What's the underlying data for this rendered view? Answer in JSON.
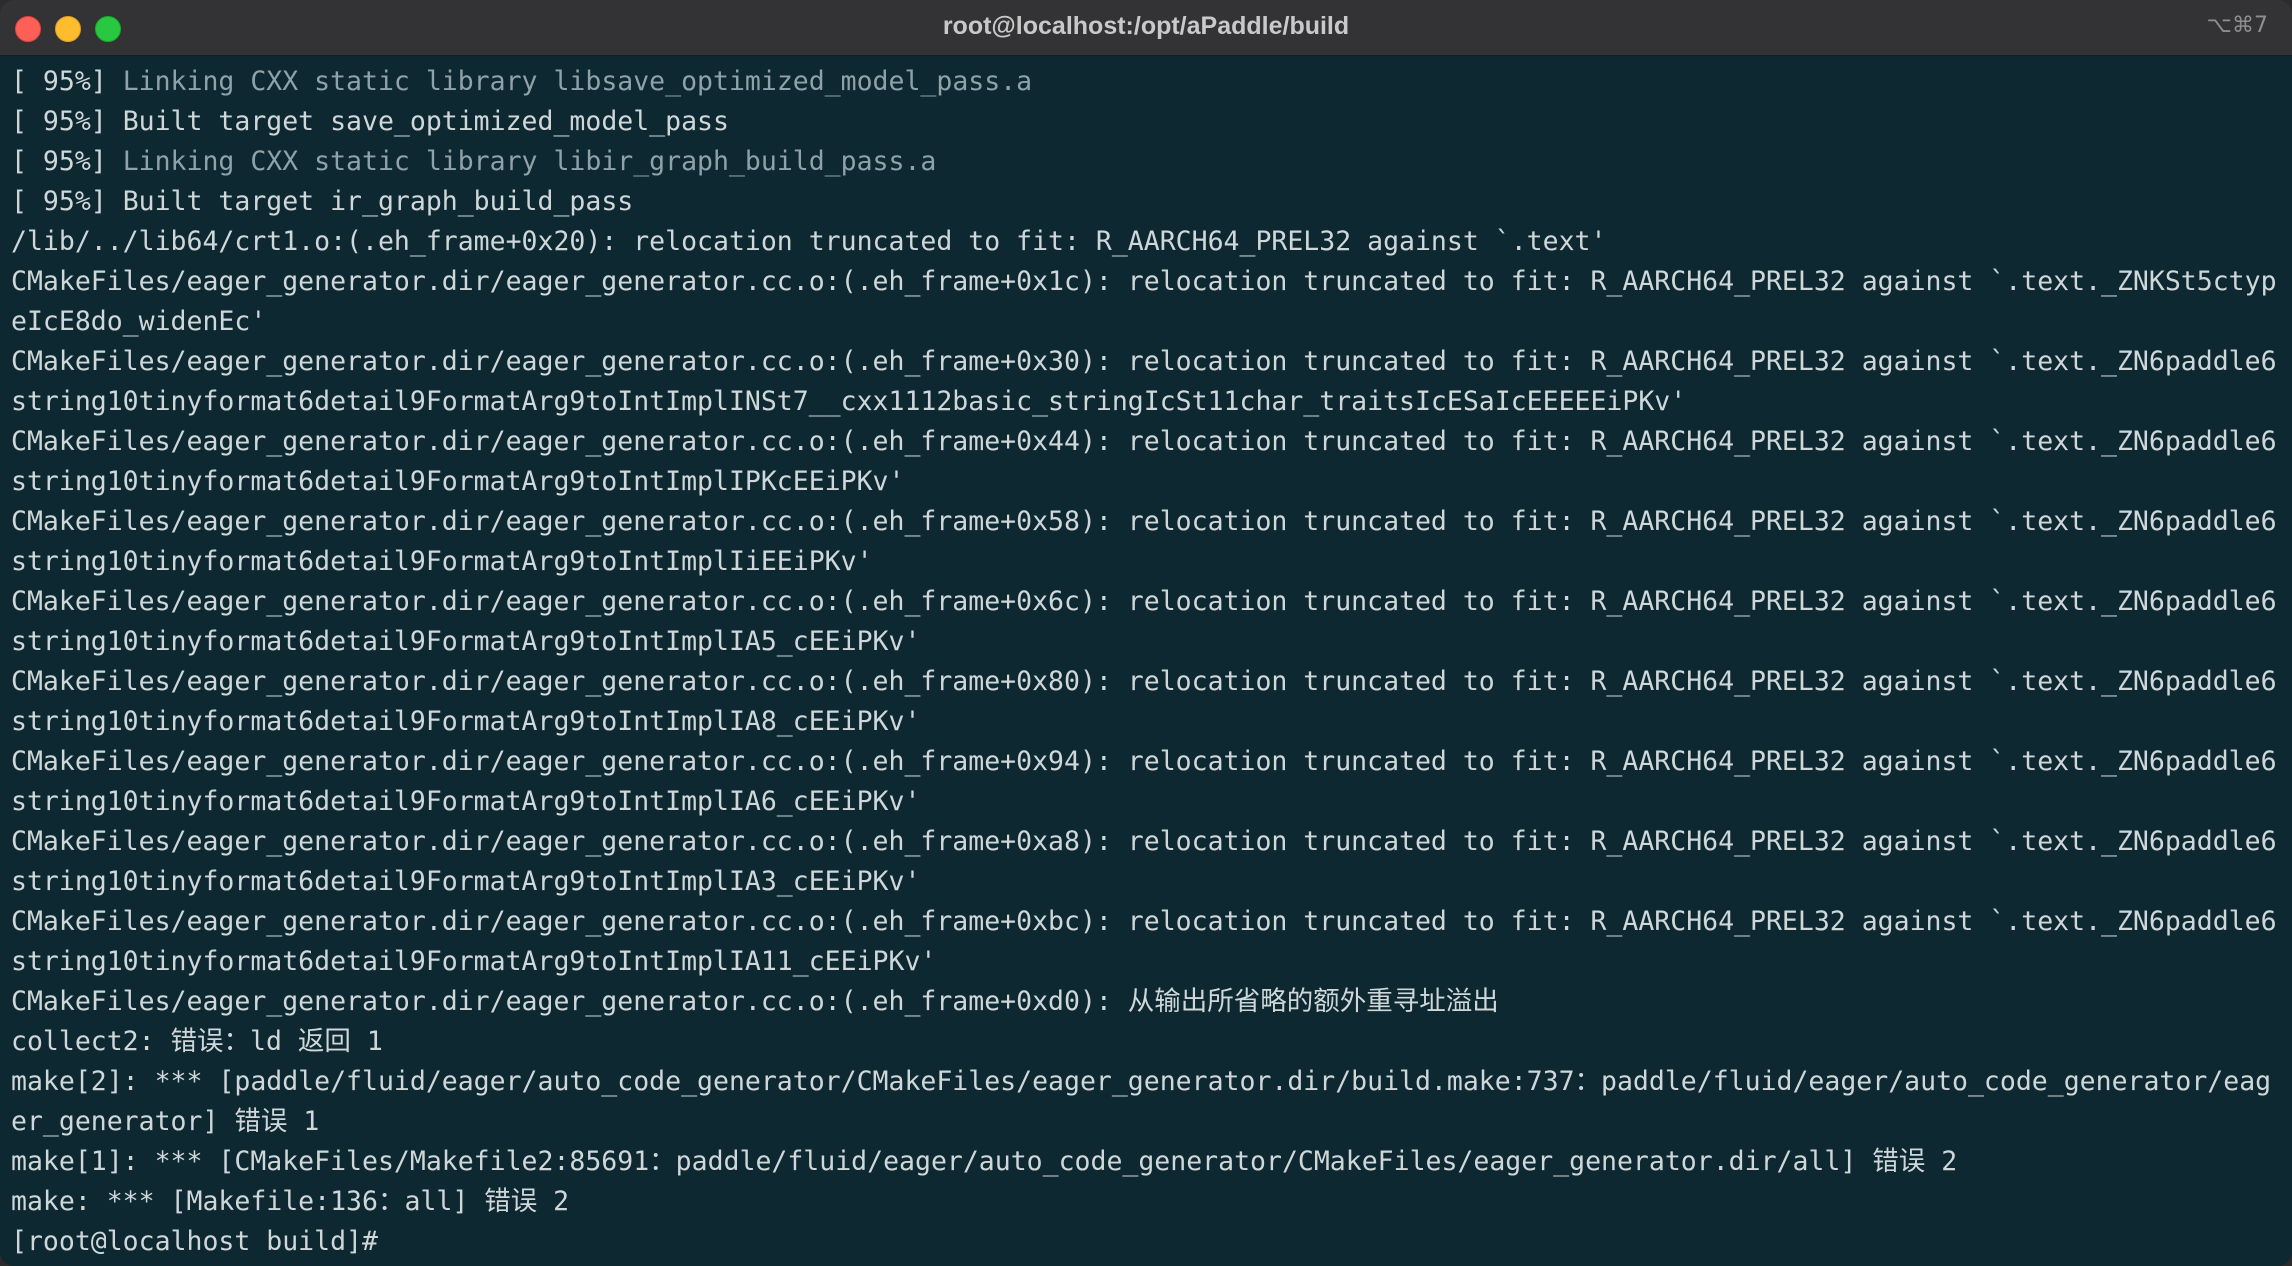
{
  "window": {
    "title": "root@localhost:/opt/aPaddle/build",
    "shortcut": "⌥⌘7"
  },
  "terminal": {
    "lines": [
      {
        "progress": "[ 95%] ",
        "text": "Linking CXX static library libsave_optimized_model_pass.a",
        "dim": true
      },
      {
        "progress": "[ 95%] ",
        "text": "Built target save_optimized_model_pass",
        "dim": false
      },
      {
        "progress": "[ 95%] ",
        "text": "Linking CXX static library libir_graph_build_pass.a",
        "dim": true
      },
      {
        "progress": "[ 95%] ",
        "text": "Built target ir_graph_build_pass",
        "dim": false
      },
      {
        "progress": "",
        "text": "/lib/../lib64/crt1.o:(.eh_frame+0x20): relocation truncated to fit: R_AARCH64_PREL32 against `.text'",
        "dim": false
      },
      {
        "progress": "",
        "text": "CMakeFiles/eager_generator.dir/eager_generator.cc.o:(.eh_frame+0x1c): relocation truncated to fit: R_AARCH64_PREL32 against `.text._ZNKSt5ctyp",
        "dim": false
      },
      {
        "progress": "",
        "text": "eIcE8do_widenEc'",
        "dim": false
      },
      {
        "progress": "",
        "text": "CMakeFiles/eager_generator.dir/eager_generator.cc.o:(.eh_frame+0x30): relocation truncated to fit: R_AARCH64_PREL32 against `.text._ZN6paddle6",
        "dim": false
      },
      {
        "progress": "",
        "text": "string10tinyformat6detail9FormatArg9toIntImplINSt7__cxx1112basic_stringIcSt11char_traitsIcESaIcEEEEEiPKv'",
        "dim": false
      },
      {
        "progress": "",
        "text": "CMakeFiles/eager_generator.dir/eager_generator.cc.o:(.eh_frame+0x44): relocation truncated to fit: R_AARCH64_PREL32 against `.text._ZN6paddle6",
        "dim": false
      },
      {
        "progress": "",
        "text": "string10tinyformat6detail9FormatArg9toIntImplIPKcEEiPKv'",
        "dim": false
      },
      {
        "progress": "",
        "text": "CMakeFiles/eager_generator.dir/eager_generator.cc.o:(.eh_frame+0x58): relocation truncated to fit: R_AARCH64_PREL32 against `.text._ZN6paddle6",
        "dim": false
      },
      {
        "progress": "",
        "text": "string10tinyformat6detail9FormatArg9toIntImplIiEEiPKv'",
        "dim": false
      },
      {
        "progress": "",
        "text": "CMakeFiles/eager_generator.dir/eager_generator.cc.o:(.eh_frame+0x6c): relocation truncated to fit: R_AARCH64_PREL32 against `.text._ZN6paddle6",
        "dim": false
      },
      {
        "progress": "",
        "text": "string10tinyformat6detail9FormatArg9toIntImplIA5_cEEiPKv'",
        "dim": false
      },
      {
        "progress": "",
        "text": "CMakeFiles/eager_generator.dir/eager_generator.cc.o:(.eh_frame+0x80): relocation truncated to fit: R_AARCH64_PREL32 against `.text._ZN6paddle6",
        "dim": false
      },
      {
        "progress": "",
        "text": "string10tinyformat6detail9FormatArg9toIntImplIA8_cEEiPKv'",
        "dim": false
      },
      {
        "progress": "",
        "text": "CMakeFiles/eager_generator.dir/eager_generator.cc.o:(.eh_frame+0x94): relocation truncated to fit: R_AARCH64_PREL32 against `.text._ZN6paddle6",
        "dim": false
      },
      {
        "progress": "",
        "text": "string10tinyformat6detail9FormatArg9toIntImplIA6_cEEiPKv'",
        "dim": false
      },
      {
        "progress": "",
        "text": "CMakeFiles/eager_generator.dir/eager_generator.cc.o:(.eh_frame+0xa8): relocation truncated to fit: R_AARCH64_PREL32 against `.text._ZN6paddle6",
        "dim": false
      },
      {
        "progress": "",
        "text": "string10tinyformat6detail9FormatArg9toIntImplIA3_cEEiPKv'",
        "dim": false
      },
      {
        "progress": "",
        "text": "CMakeFiles/eager_generator.dir/eager_generator.cc.o:(.eh_frame+0xbc): relocation truncated to fit: R_AARCH64_PREL32 against `.text._ZN6paddle6",
        "dim": false
      },
      {
        "progress": "",
        "text": "string10tinyformat6detail9FormatArg9toIntImplIA11_cEEiPKv'",
        "dim": false
      },
      {
        "progress": "",
        "text": "CMakeFiles/eager_generator.dir/eager_generator.cc.o:(.eh_frame+0xd0): 从输出所省略的额外重寻址溢出",
        "dim": false
      },
      {
        "progress": "",
        "text": "collect2: 错误：ld 返回 1",
        "dim": false
      },
      {
        "progress": "",
        "text": "make[2]: *** [paddle/fluid/eager/auto_code_generator/CMakeFiles/eager_generator.dir/build.make:737：paddle/fluid/eager/auto_code_generator/eag",
        "dim": false
      },
      {
        "progress": "",
        "text": "er_generator] 错误 1",
        "dim": false
      },
      {
        "progress": "",
        "text": "make[1]: *** [CMakeFiles/Makefile2:85691：paddle/fluid/eager/auto_code_generator/CMakeFiles/eager_generator.dir/all] 错误 2",
        "dim": false
      },
      {
        "progress": "",
        "text": "make: *** [Makefile:136：all] 错误 2",
        "dim": false
      }
    ],
    "prompt": "[root@localhost build]# "
  }
}
